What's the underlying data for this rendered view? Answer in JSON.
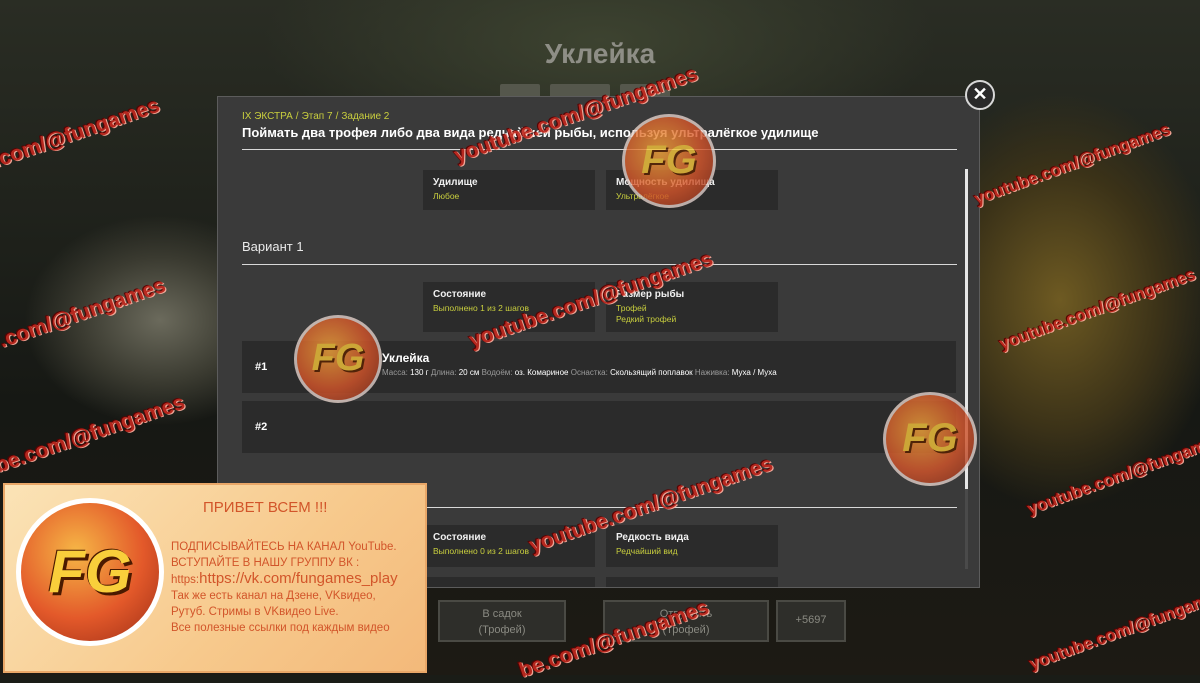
{
  "background": {
    "title": "Уклейка",
    "btn_keep_line1": "В садок",
    "btn_keep_line2": "(Трофей)",
    "btn_release_line1": "Отпустить",
    "btn_release_line2": "(Трофей)",
    "btn_coins": "+5697"
  },
  "modal": {
    "breadcrumbs": [
      "IX ЭКСТРА",
      "Этап 7",
      "Задание 2"
    ],
    "title": "Поймать два трофея либо два вида редчайшей рыбы, используя ультралёгкое удилище",
    "rod_card": {
      "title": "Удилище",
      "value": "Любое"
    },
    "power_card": {
      "title": "Мощность удилища",
      "value": "Ультралёгкое"
    },
    "variant1": {
      "label": "Вариант 1",
      "state_card": {
        "title": "Состояние",
        "value": "Выполнено 1 из 2 шагов"
      },
      "size_card": {
        "title": "Размер рыбы",
        "values": [
          "Трофей",
          "Редкий трофей"
        ]
      },
      "slots": [
        {
          "num": "#1",
          "fish": "Уклейка",
          "mass_label": "Масса:",
          "mass": "130 г",
          "length_label": "Длина:",
          "length": "20 см",
          "water_label": "Водоём:",
          "water": "оз. Комариное",
          "tackle_label": "Оснастка:",
          "tackle": "Скользящий поплавок",
          "bait_label": "Наживка:",
          "bait": "Муха / Муха"
        },
        {
          "num": "#2"
        }
      ]
    },
    "variant2": {
      "state_card": {
        "title": "Состояние",
        "value": "Выполнено 0 из 2 шагов"
      },
      "rarity_card": {
        "title": "Редкость вида",
        "value": "Редчайший вид"
      }
    },
    "close_symbol": "✕"
  },
  "watermark": {
    "text_full": "youtube.com/@fungames",
    "text_cut": ".com/@fungames",
    "text_cut2": "be.com/@fungames",
    "logo_text": "FG"
  },
  "promo": {
    "logo_text": "FG",
    "greeting": "ПРИВЕТ ВСЕМ !!!",
    "line1": "ПОДПИСЫВАЙТЕСЬ НА КАНАЛ YouTube.",
    "line2": "ВСТУПАЙТЕ В НАШУ ГРУППУ ВК :",
    "line3_prefix": "https:",
    "line3_link": "https://vk.com/fungames_play",
    "line4": "Так же есть канал на Дзене, VKвидео,",
    "line5": "Рутуб. Стримы в VKвидео Live.",
    "line6": "Все полезные ссылки под каждым видео"
  },
  "colors": {
    "accent": "#c9cf3e",
    "modal_bg": "#3a3a3a",
    "card_bg": "#2b2b2b",
    "watermark": "#c2281e",
    "promo_text": "#d2552a"
  }
}
